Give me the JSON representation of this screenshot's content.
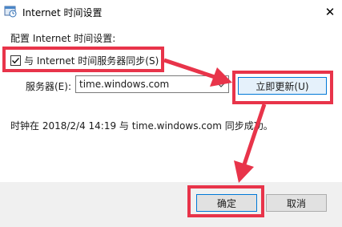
{
  "window": {
    "title": "Internet 时间设置",
    "close_glyph": "✕"
  },
  "settings": {
    "section_label": "配置 Internet 时间设置:",
    "sync_checkbox_label": "与 Internet 时间服务器同步(S)",
    "sync_checked": true,
    "server_label": "服务器(E):",
    "server_value": "time.windows.com",
    "update_button": "立即更新(U)",
    "status_message": "时钟在 2018/2/4 14:19 与 time.windows.com 同步成功。"
  },
  "footer": {
    "ok_label": "确定",
    "cancel_label": "取消"
  },
  "colors": {
    "annotation": "#e8344a",
    "accent": "#0078d7"
  },
  "icons": [
    "clock-settings-icon",
    "close-icon",
    "check-icon",
    "chevron-down-icon"
  ]
}
